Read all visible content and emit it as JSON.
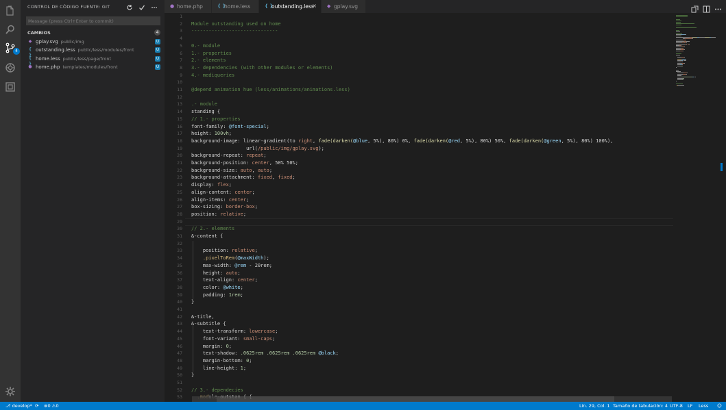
{
  "activity_bar": {
    "icons": [
      "explorer-icon",
      "search-icon",
      "source-control-icon",
      "debug-icon",
      "extensions-icon",
      "settings-gear-icon"
    ],
    "scm_badge": "4"
  },
  "sidebar": {
    "title": "CONTROL DE CÓDIGO FUENTE: GIT",
    "actions": [
      "refresh-icon",
      "commit-check-icon",
      "more-icon"
    ],
    "commit_placeholder": "Message (press Ctrl+Enter to commit)",
    "changes_label": "CAMBIOS",
    "changes_count": "4",
    "files": [
      {
        "name": "gplay.svg",
        "path": "public/img",
        "icon": "{ }",
        "icon_color": "#a074c4",
        "status": "U"
      },
      {
        "name": "outstanding.less",
        "path": "public/less/modules/front",
        "icon": "{ }",
        "icon_color": "#519aba",
        "status": "U"
      },
      {
        "name": "home.less",
        "path": "public/less/page/front",
        "icon": "{ }",
        "icon_color": "#519aba",
        "status": "U"
      },
      {
        "name": "home.php",
        "path": "templates/modules/front",
        "icon": "php",
        "icon_color": "#a074c4",
        "status": "U"
      }
    ]
  },
  "tabs": [
    {
      "label": "home.php",
      "icon": "php",
      "icon_color": "#a074c4",
      "active": false
    },
    {
      "label": "home.less",
      "icon": "{ }",
      "icon_color": "#519aba",
      "active": false
    },
    {
      "label": "outstanding.less",
      "icon": "{ }",
      "icon_color": "#519aba",
      "active": true,
      "close": "×"
    },
    {
      "label": "gplay.svg",
      "icon": "svg",
      "icon_color": "#a074c4",
      "active": false
    }
  ],
  "editor": {
    "line_numbers": [
      "1",
      "2",
      "3",
      "4",
      "5",
      "6",
      "7",
      "8",
      "9",
      "10",
      "11",
      "12",
      "13",
      "14",
      "15",
      "16",
      "17",
      "18",
      "19",
      "20",
      "21",
      "22",
      "23",
      "24",
      "25",
      "26",
      "27",
      "28",
      "29",
      "30",
      "31",
      "32",
      "33",
      "34",
      "35",
      "36",
      "37",
      "38",
      "39",
      "40",
      "41",
      "42",
      "43",
      "44",
      "45",
      "46",
      "47",
      "48",
      "49",
      "50",
      "51",
      "52",
      "53"
    ],
    "lines": [
      [],
      [
        [
          "Module outstanding used on home",
          "c-cm"
        ]
      ],
      [
        [
          "------------------------------",
          "c-cm"
        ]
      ],
      [],
      [
        [
          "0.- module",
          "c-cm"
        ]
      ],
      [
        [
          "1.- properties",
          "c-cm"
        ]
      ],
      [
        [
          "2.- elements",
          "c-cm"
        ]
      ],
      [
        [
          "3.- dependencies (with other modules or elements)",
          "c-cm"
        ]
      ],
      [
        [
          "4.- mediqueries",
          "c-cm"
        ]
      ],
      [],
      [
        [
          "@depend animation hue (less/animations/animations.less)",
          "c-cm"
        ]
      ],
      [],
      [
        [
          ".- module",
          "c-cm"
        ]
      ],
      [
        [
          "standing {",
          "c-def"
        ]
      ],
      [
        [
          "// 1.- properties",
          "c-cm"
        ]
      ],
      [
        [
          "font-family: ",
          "c-def"
        ],
        [
          "@font-special",
          "c-var"
        ],
        [
          ";",
          "c-def"
        ]
      ],
      [
        [
          "height: ",
          "c-def"
        ],
        [
          "100vh",
          "c-num"
        ],
        [
          ";",
          "c-def"
        ]
      ],
      [
        [
          "background-image: ",
          "c-def"
        ],
        [
          "linear-gradient(to ",
          "c-def"
        ],
        [
          "right",
          "c-val"
        ],
        [
          ", ",
          "c-def"
        ],
        [
          "fade(",
          "c-fn"
        ],
        [
          "darken(",
          "c-fn"
        ],
        [
          "@blue",
          "c-var"
        ],
        [
          ", 5%), 80%) 0%, ",
          "c-def"
        ],
        [
          "fade(",
          "c-fn"
        ],
        [
          "darken(",
          "c-fn"
        ],
        [
          "@red",
          "c-var"
        ],
        [
          ", 5%), 80%) 50%, ",
          "c-def"
        ],
        [
          "fade(",
          "c-fn"
        ],
        [
          "darken(",
          "c-fn"
        ],
        [
          "@green",
          "c-var"
        ],
        [
          ", 5%), 80%) 100%),",
          "c-def"
        ]
      ],
      [
        [
          "                   url(",
          "c-def"
        ],
        [
          "/public/img/gplay.svg",
          "c-val"
        ],
        [
          ");",
          "c-def"
        ]
      ],
      [
        [
          "background-repeat: ",
          "c-def"
        ],
        [
          "repeat",
          "c-val"
        ],
        [
          ";",
          "c-def"
        ]
      ],
      [
        [
          "background-position: ",
          "c-def"
        ],
        [
          "center",
          "c-val"
        ],
        [
          ", 50% 50%;",
          "c-def"
        ]
      ],
      [
        [
          "background-size: ",
          "c-def"
        ],
        [
          "auto",
          "c-val"
        ],
        [
          ", ",
          "c-def"
        ],
        [
          "auto",
          "c-val"
        ],
        [
          ";",
          "c-def"
        ]
      ],
      [
        [
          "background-attachment: ",
          "c-def"
        ],
        [
          "fixed",
          "c-val"
        ],
        [
          ", ",
          "c-def"
        ],
        [
          "fixed",
          "c-val"
        ],
        [
          ";",
          "c-def"
        ]
      ],
      [
        [
          "display: ",
          "c-def"
        ],
        [
          "flex",
          "c-val"
        ],
        [
          ";",
          "c-def"
        ]
      ],
      [
        [
          "align-content: ",
          "c-def"
        ],
        [
          "center",
          "c-val"
        ],
        [
          ";",
          "c-def"
        ]
      ],
      [
        [
          "align-items: ",
          "c-def"
        ],
        [
          "center",
          "c-val"
        ],
        [
          ";",
          "c-def"
        ]
      ],
      [
        [
          "box-sizing: ",
          "c-def"
        ],
        [
          "border-box",
          "c-val"
        ],
        [
          ";",
          "c-def"
        ]
      ],
      [
        [
          "position: ",
          "c-def"
        ],
        [
          "relative",
          "c-val"
        ],
        [
          ";",
          "c-def"
        ]
      ],
      [],
      [
        [
          "// 2.- elements",
          "c-cm"
        ]
      ],
      [
        [
          "&-content {",
          "c-def"
        ]
      ],
      [],
      [
        [
          "    position: ",
          "c-def"
        ],
        [
          "relative",
          "c-val"
        ],
        [
          ";",
          "c-def"
        ]
      ],
      [
        [
          "    .pixelToRem",
          "c-sel"
        ],
        [
          "(",
          "c-def"
        ],
        [
          "@maxWidth",
          "c-var"
        ],
        [
          ");",
          "c-def"
        ]
      ],
      [
        [
          "    max-width: ",
          "c-def"
        ],
        [
          "@rem",
          "c-var"
        ],
        [
          " - 20rem;",
          "c-def"
        ]
      ],
      [
        [
          "    height: ",
          "c-def"
        ],
        [
          "auto",
          "c-val"
        ],
        [
          ";",
          "c-def"
        ]
      ],
      [
        [
          "    text-align: ",
          "c-def"
        ],
        [
          "center",
          "c-val"
        ],
        [
          ";",
          "c-def"
        ]
      ],
      [
        [
          "    color: ",
          "c-def"
        ],
        [
          "@white",
          "c-var"
        ],
        [
          ";",
          "c-def"
        ]
      ],
      [
        [
          "    padding: ",
          "c-def"
        ],
        [
          "1rem",
          "c-num"
        ],
        [
          ";",
          "c-def"
        ]
      ],
      [
        [
          "}",
          "c-def"
        ]
      ],
      [],
      [
        [
          "&-title,",
          "c-def"
        ]
      ],
      [
        [
          "&-subtitle {",
          "c-def"
        ]
      ],
      [
        [
          "    text-transform: ",
          "c-def"
        ],
        [
          "lowercase",
          "c-val"
        ],
        [
          ";",
          "c-def"
        ]
      ],
      [
        [
          "    font-variant: ",
          "c-def"
        ],
        [
          "small-caps",
          "c-val"
        ],
        [
          ";",
          "c-def"
        ]
      ],
      [
        [
          "    margin: ",
          "c-def"
        ],
        [
          "0",
          "c-num"
        ],
        [
          ";",
          "c-def"
        ]
      ],
      [
        [
          "    text-shadow: ",
          "c-def"
        ],
        [
          ".0625rem .0625rem .0625rem ",
          "c-num"
        ],
        [
          "@black",
          "c-var"
        ],
        [
          ";",
          "c-def"
        ]
      ],
      [
        [
          "    margin-bottom: ",
          "c-def"
        ],
        [
          "0",
          "c-num"
        ],
        [
          ";",
          "c-def"
        ]
      ],
      [
        [
          "    line-height: ",
          "c-def"
        ],
        [
          "1",
          "c-num"
        ],
        [
          ";",
          "c-def"
        ]
      ],
      [
        [
          "}",
          "c-def"
        ]
      ],
      [],
      [
        [
          "// 3.- dependecies",
          "c-cm"
        ]
      ],
      [
        [
          "  .mod",
          "c-sel"
        ],
        [
          "ule-outstan { {",
          "c-def"
        ]
      ]
    ]
  },
  "statusbar": {
    "branch": "develop*",
    "sync_icon": "sync-icon",
    "errors": "0",
    "warnings": "0",
    "cursor": "Lín. 29, Col. 1",
    "tab_size": "Tamaño de tabulación: 4",
    "encoding": "UTF-8",
    "eol": "LF",
    "language": "Less"
  },
  "colors": {
    "accent": "#007acc",
    "comment": "#608b4e"
  }
}
